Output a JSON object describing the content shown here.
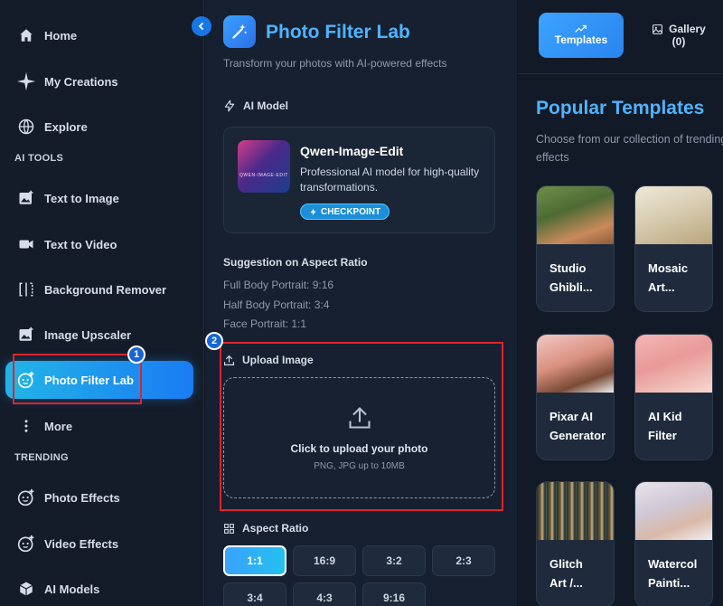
{
  "sidebar": {
    "items": [
      {
        "label": "Home",
        "icon": "home-icon"
      },
      {
        "label": "My Creations",
        "icon": "sparkle-icon"
      },
      {
        "label": "Explore",
        "icon": "globe-icon"
      },
      {
        "label": "Text to Image",
        "icon": "image-plus-icon"
      },
      {
        "label": "Text to Video",
        "icon": "video-icon"
      },
      {
        "label": "Background Remover",
        "icon": "background-remover-icon"
      },
      {
        "label": "Image Upscaler",
        "icon": "upscale-icon"
      },
      {
        "label": "Photo Filter Lab",
        "icon": "face-filter-icon"
      },
      {
        "label": "More",
        "icon": "more-vertical-icon"
      },
      {
        "label": "Photo Effects",
        "icon": "face-filter-icon"
      },
      {
        "label": "Video Effects",
        "icon": "face-filter-icon"
      },
      {
        "label": "AI Models",
        "icon": "cube-icon"
      }
    ],
    "sections": {
      "ai_tools": "AI TOOLS",
      "trending": "TRENDING"
    },
    "active_item": "Photo Filter Lab"
  },
  "annotations": {
    "badge1": "1",
    "badge2": "2"
  },
  "panel": {
    "title": "Photo Filter Lab",
    "subtitle": "Transform your photos with AI-powered effects",
    "ai_model_heading": "AI Model",
    "model": {
      "thumb_text": "QWEN-IMAGE-EDIT",
      "name": "Qwen-Image-Edit",
      "description": "Professional AI model for high-quality transformations.",
      "badge": "CHECKPOINT"
    },
    "suggestion": {
      "title": "Suggestion on Aspect Ratio",
      "lines": [
        "Full Body Portrait: 9:16",
        "Half Body Portrait: 3:4",
        "Face Portrait: 1:1"
      ]
    },
    "upload": {
      "heading": "Upload Image",
      "main": "Click to upload your photo",
      "sub": "PNG, JPG up to 10MB"
    },
    "aspect": {
      "heading": "Aspect Ratio",
      "options": [
        "1:1",
        "16:9",
        "3:2",
        "2:3",
        "3:4",
        "4:3",
        "9:16"
      ],
      "selected": "1:1"
    }
  },
  "right": {
    "tabs": {
      "templates": "Templates",
      "gallery": "Gallery",
      "gallery_count": "(0)"
    },
    "popular_title": "Popular Templates",
    "popular_sub": "Choose from our collection of trending effects",
    "cards": [
      {
        "line1": "Studio",
        "line2": "Ghibli..."
      },
      {
        "line1": "Mosaic",
        "line2": "Art..."
      },
      {
        "line1": "Pixar AI",
        "line2": "Generator"
      },
      {
        "line1": "AI Kid",
        "line2": "Filter"
      },
      {
        "line1": "Glitch",
        "line2": "Art /..."
      },
      {
        "line1": "Watercol",
        "line2": "Painti..."
      }
    ]
  },
  "colors": {
    "accent": "#4fb3ff",
    "active_nav": "#1c8cf0",
    "annotation": "#e0242b"
  }
}
